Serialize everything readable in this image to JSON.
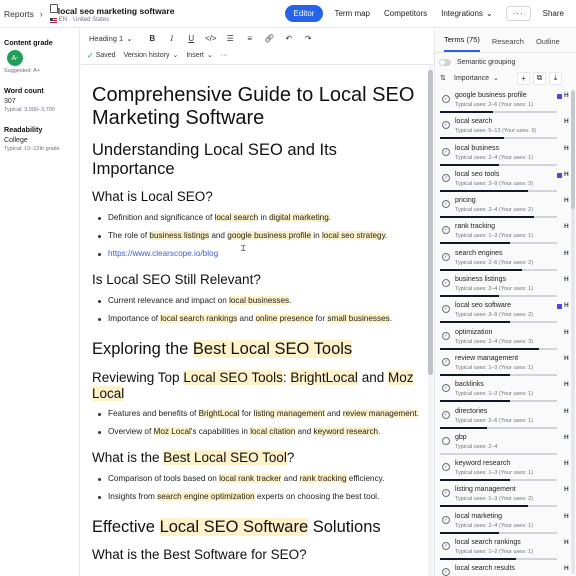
{
  "topbar": {
    "breadcrumb": "Reports",
    "title": "local seo marketing software",
    "subtitle_lang": "EN",
    "subtitle_sep": "·",
    "subtitle_country": "United States",
    "nav": [
      {
        "label": "Editor",
        "active": true
      },
      {
        "label": "Term map",
        "active": false
      },
      {
        "label": "Competitors",
        "active": false
      },
      {
        "label": "Integrations",
        "active": false
      }
    ],
    "more_label": "···",
    "share_label": "Share"
  },
  "left": {
    "grade_label": "Content grade",
    "grade_value": "A-",
    "grade_suggested": "Suggested: A+",
    "wordcount_label": "Word count",
    "wordcount_value": "307",
    "wordcount_typical": "Typical: 3,000–3,700",
    "readability_label": "Readability",
    "readability_value": "College",
    "readability_typical": "Typical: 10–12th grade"
  },
  "toolbar": {
    "heading_label": "Heading 1",
    "saved_label": "Saved",
    "version_label": "Version history",
    "insert_label": "Insert",
    "more_label": "···"
  },
  "doc": {
    "h1": "Comprehensive Guide to Local SEO Marketing Software",
    "s1_h2": "Understanding Local SEO and Its Importance",
    "s1_h3a": "What is Local SEO?",
    "s1_b1": [
      "Definition and significance of ",
      "local search",
      " in ",
      "digital marketing",
      "."
    ],
    "s1_b2": [
      "The role of ",
      "business listings",
      " and ",
      "google business profile",
      " in ",
      "local seo strategy",
      "."
    ],
    "s1_b3": "https://www.clearscope.io/blog",
    "s1_h3b": "Is Local SEO Still Relevant?",
    "s1_b4": [
      "Current relevance and impact on ",
      "local businesses",
      "."
    ],
    "s1_b5": [
      "Importance of ",
      "local search rankings",
      " and ",
      "online presence",
      " for ",
      "small businesses",
      "."
    ],
    "s2_h2": [
      "Exploring the ",
      "Best Local SEO Tools"
    ],
    "s2_h3a": [
      "Reviewing Top ",
      "Local SEO Tools",
      ": ",
      "BrightLocal",
      " and ",
      "Moz Local"
    ],
    "s2_b1": [
      "Features and benefits of ",
      "BrightLocal",
      " for ",
      "listing management",
      " and ",
      "review management",
      "."
    ],
    "s2_b2": [
      "Overview of ",
      "Moz Local",
      "'s capabilities in ",
      "local citation",
      " and ",
      "keyword research",
      "."
    ],
    "s2_h3b": [
      "What is the ",
      "Best Local SEO Tool",
      "?"
    ],
    "s2_b3": [
      "Comparison of tools based on ",
      "local rank tracker",
      " and ",
      "rank tracking",
      " efficiency."
    ],
    "s2_b4": [
      "Insights from ",
      "search engine optimization",
      " experts on choosing the best tool."
    ],
    "s3_h2": [
      "Effective ",
      "Local SEO Software",
      " Solutions"
    ],
    "s3_h3a": "What is the Best Software for SEO?"
  },
  "right": {
    "tabs": [
      "Terms (75)",
      "Research",
      "Outline"
    ],
    "semantic_label": "Semantic grouping",
    "sort_label": "Importance",
    "terms": [
      {
        "name": "google business profile",
        "uses": "Typical uses: 2–6 (Your uses: 1)",
        "fill": 0.45,
        "flag": true,
        "check": "✓"
      },
      {
        "name": "local search",
        "uses": "Typical uses: 5–13 (Your uses: 3)",
        "fill": 0.55,
        "flag": false,
        "check": "✓"
      },
      {
        "name": "local business",
        "uses": "Typical uses: 2–4 (Your uses: 1)",
        "fill": 0.5,
        "flag": false,
        "check": "✓"
      },
      {
        "name": "local seo tools",
        "uses": "Typical uses: 3–9 (Your uses: 3)",
        "fill": 0.75,
        "flag": true,
        "check": "✓"
      },
      {
        "name": "pricing",
        "uses": "Typical uses: 2–4 (Your uses: 2)",
        "fill": 0.8,
        "flag": false,
        "check": "✓"
      },
      {
        "name": "rank tracking",
        "uses": "Typical uses: 1–3 (Your uses: 1)",
        "fill": 0.6,
        "flag": false,
        "check": "✓"
      },
      {
        "name": "search engines",
        "uses": "Typical uses: 2–6 (Your uses: 2)",
        "fill": 0.7,
        "flag": false,
        "check": "✓"
      },
      {
        "name": "business listings",
        "uses": "Typical uses: 2–4 (Your uses: 1)",
        "fill": 0.5,
        "flag": false,
        "check": "✓"
      },
      {
        "name": "local seo software",
        "uses": "Typical uses: 3–9 (Your uses: 2)",
        "fill": 0.6,
        "flag": true,
        "check": "✓"
      },
      {
        "name": "optimization",
        "uses": "Typical uses: 2–4 (Your uses: 3)",
        "fill": 0.85,
        "flag": false,
        "check": "✓"
      },
      {
        "name": "review management",
        "uses": "Typical uses: 1–3 (Your uses: 1)",
        "fill": 0.6,
        "flag": false,
        "check": "✓"
      },
      {
        "name": "backlinks",
        "uses": "Typical uses: 1–3 (Your uses: 1)",
        "fill": 0.6,
        "flag": false,
        "check": "✓"
      },
      {
        "name": "directories",
        "uses": "Typical uses: 2–6 (Your uses: 1)",
        "fill": 0.4,
        "flag": false,
        "check": "✓"
      },
      {
        "name": "gbp",
        "uses": "Typical uses: 2–4",
        "fill": 0.0,
        "flag": false,
        "check": ""
      },
      {
        "name": "keyword research",
        "uses": "Typical uses: 1–3 (Your uses: 1)",
        "fill": 0.6,
        "flag": false,
        "check": "✓"
      },
      {
        "name": "listing management",
        "uses": "Typical uses: 1–3 (Your uses: 2)",
        "fill": 0.75,
        "flag": false,
        "check": "✓"
      },
      {
        "name": "local marketing",
        "uses": "Typical uses: 2–4 (Your uses: 1)",
        "fill": 0.5,
        "flag": false,
        "check": "✓"
      },
      {
        "name": "local search rankings",
        "uses": "Typical uses: 1–2 (Your uses: 1)",
        "fill": 0.65,
        "flag": false,
        "check": "✓"
      },
      {
        "name": "local search results",
        "uses": "",
        "fill": 0.0,
        "flag": false,
        "check": "✓"
      }
    ]
  }
}
